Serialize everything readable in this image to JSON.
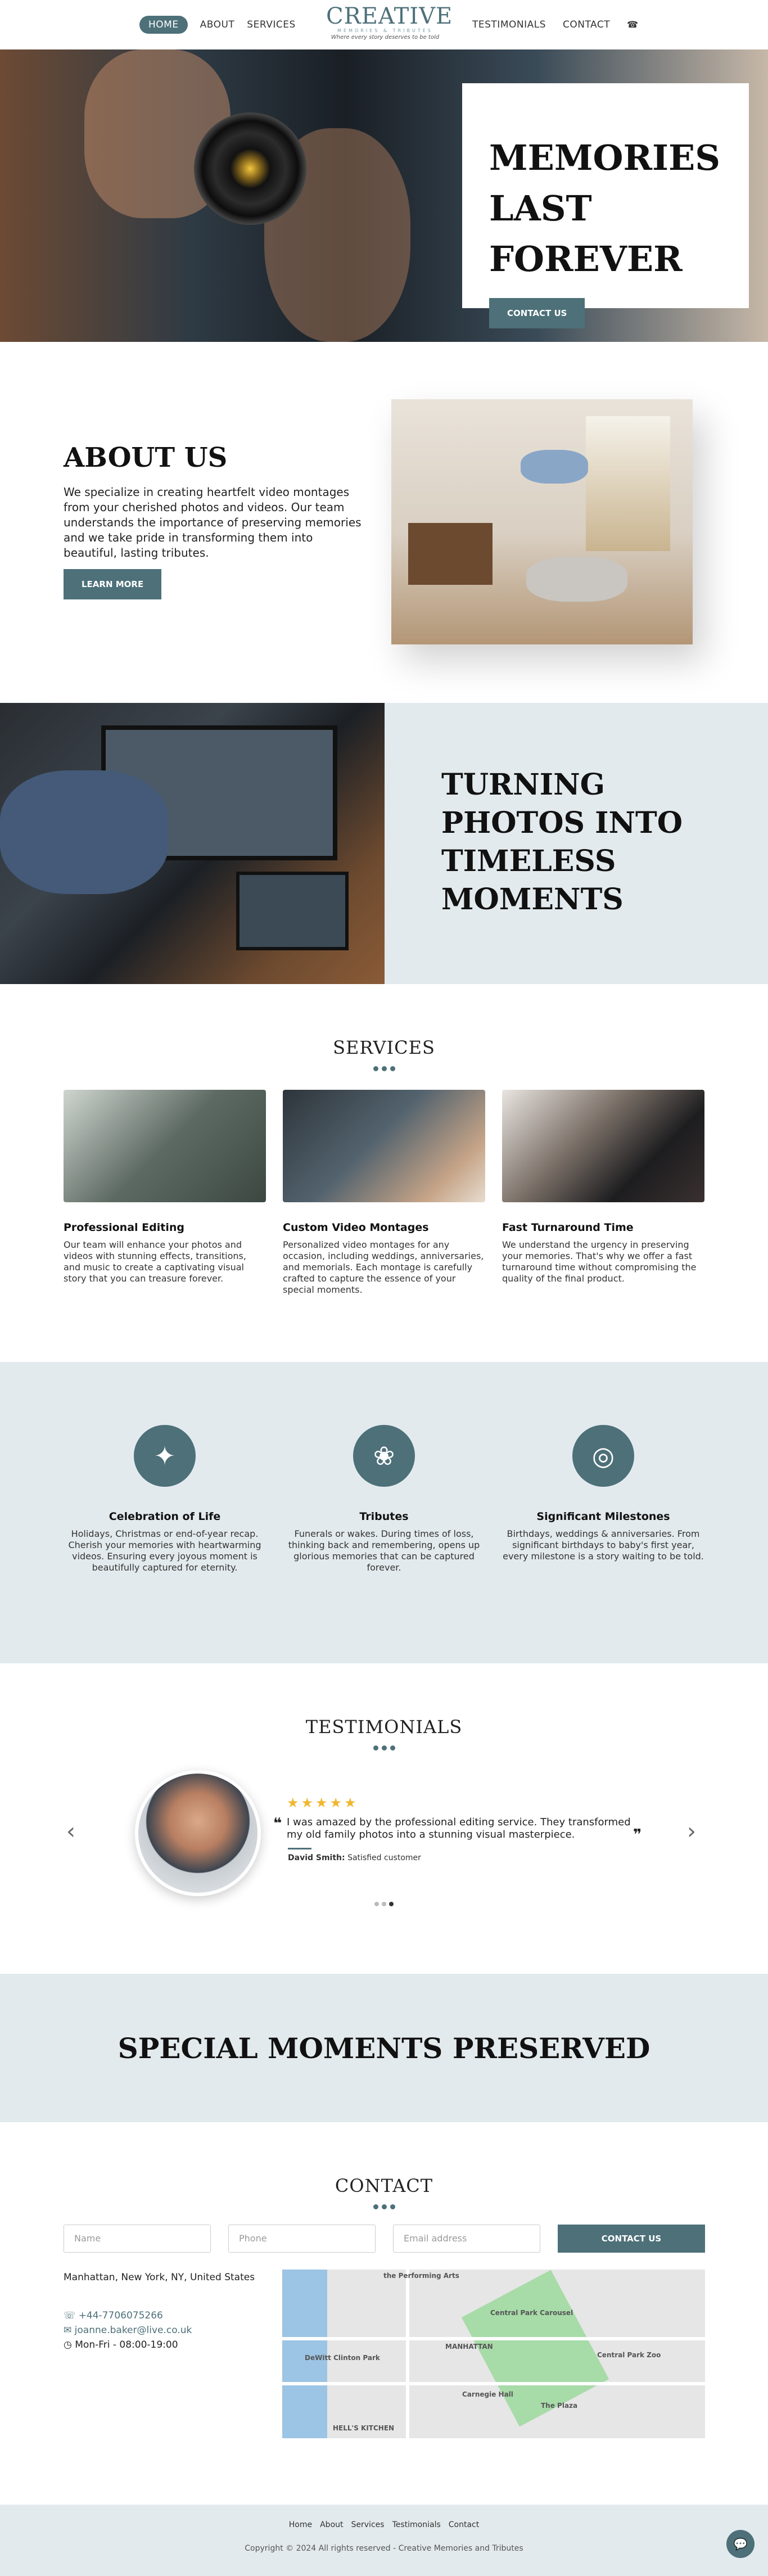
{
  "nav": {
    "home": "HOME",
    "about": "ABOUT",
    "services": "SERVICES",
    "testimonials": "TESTIMONIALS",
    "contact": "CONTACT",
    "logo_title": "CREATIVE",
    "logo_sub": "MEMORIES & TRIBUTES",
    "logo_tagline": "Where every story deserves to be told",
    "phone_icon": "phone-icon"
  },
  "hero": {
    "title": "MEMORIES LAST FOREVER",
    "button": "CONTACT US"
  },
  "about": {
    "title": "ABOUT US",
    "text": "We specialize in creating heartfelt video montages from your cherished photos and videos. Our team understands the importance of preserving memories and we take pride in transforming them into beautiful, lasting tributes.",
    "button": "LEARN MORE"
  },
  "turning": {
    "title": "TURNING PHOTOS INTO TIMELESS MOMENTS"
  },
  "services": {
    "title": "SERVICES",
    "items": [
      {
        "title": "Professional Editing",
        "text": "Our team will enhance your photos and videos with stunning effects, transitions, and music to create a captivating visual story that you can treasure forever."
      },
      {
        "title": "Custom Video Montages",
        "text": "Personalized video montages for any occasion, including weddings, anniversaries, and memorials. Each montage is carefully crafted to capture the essence of your special moments."
      },
      {
        "title": "Fast Turnaround Time",
        "text": "We understand the urgency in preserving your memories. That's why we offer a fast turnaround time without compromising the quality of the final product."
      }
    ]
  },
  "features": {
    "items": [
      {
        "icon": "party-popper-icon",
        "title": "Celebration of Life",
        "text": "Holidays, Christmas or end-of-year recap. Cherish your memories with heartwarming videos. Ensuring every joyous moment is beautifully captured for eternity."
      },
      {
        "icon": "bouquet-icon",
        "title": "Tributes",
        "text": "Funerals or wakes. During times of loss, thinking back and remembering, opens up glorious memories that can be captured forever."
      },
      {
        "icon": "rings-icon",
        "title": "Significant Milestones",
        "text": "Birthdays, weddings & anniversaries. From significant birthdays to baby's first year, every milestone is a story waiting to be told."
      }
    ]
  },
  "testimonials": {
    "title": "TESTIMONIALS",
    "stars": "★★★★★",
    "rating": 5,
    "quote": "I was amazed by the professional editing service. They transformed my old family photos into a stunning visual masterpiece.",
    "author": "David Smith:",
    "author_role": "Satisfied customer",
    "prev": "‹",
    "next": "›",
    "slides": 3,
    "active_slide": 3
  },
  "special": {
    "title": "SPECIAL MOMENTS PRESERVED"
  },
  "contact": {
    "title": "CONTACT",
    "name_placeholder": "Name",
    "phone_placeholder": "Phone",
    "email_placeholder": "Email address",
    "button": "CONTACT US",
    "address": "Manhattan, New York, NY, United States",
    "phone": "+44-7706075266",
    "email": "joanne.baker@live.co.uk",
    "hours": "Mon-Fri - 08:00-19:00",
    "map_labels": {
      "manhattan": "MANHATTAN",
      "central_park": "Central Park Carousel",
      "hells_kitchen": "HELL'S KITCHEN",
      "carnegie": "Carnegie Hall",
      "plaza": "The Plaza",
      "performing": "the Performing Arts",
      "zoo": "Central Park Zoo",
      "dewitt": "DeWitt Clinton Park"
    }
  },
  "footer": {
    "links": [
      "Home",
      "About",
      "Services",
      "Testimonials",
      "Contact"
    ],
    "copyright": "Copyright © 2024 All rights reserved - Creative Memories and Tributes"
  },
  "colors": {
    "accent": "#4d7079",
    "light_bg": "#e3eaed",
    "star": "#f0b72f"
  }
}
